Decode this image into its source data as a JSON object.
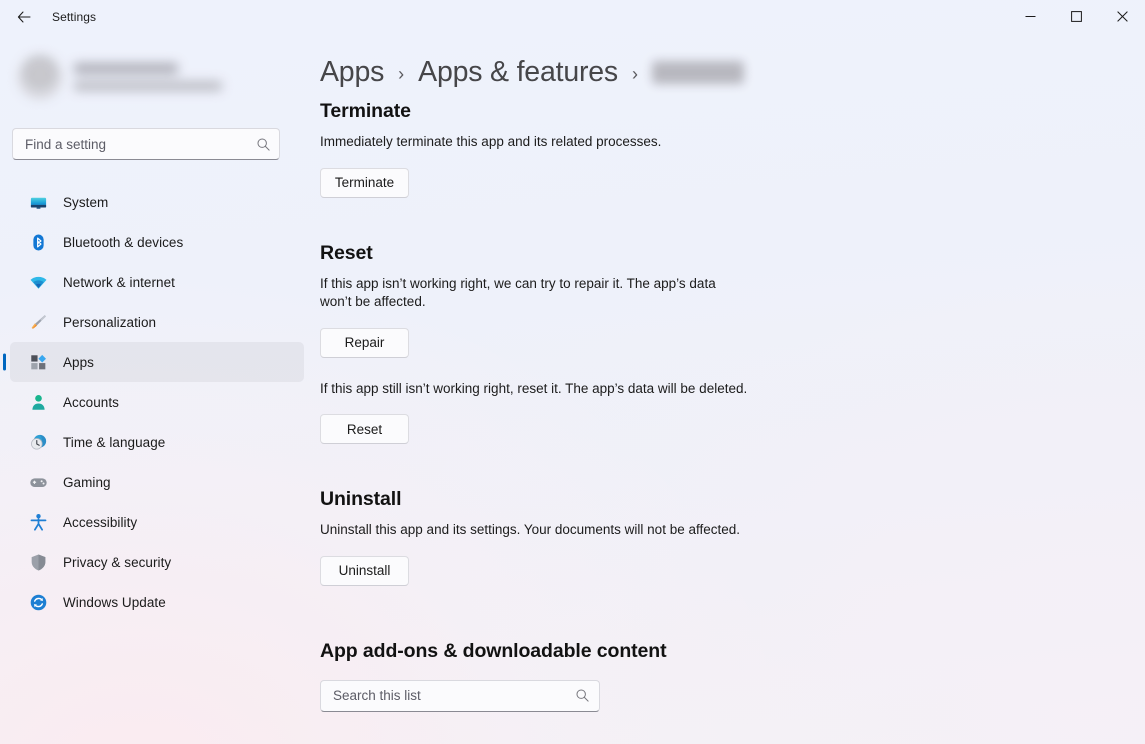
{
  "window": {
    "title": "Settings",
    "back_icon": "back-arrow-icon",
    "controls": {
      "minimize": "minimize-icon",
      "maximize": "maximize-icon",
      "close": "close-icon"
    }
  },
  "sidebar": {
    "profile": {
      "redacted": true,
      "avatar": "user-avatar"
    },
    "search": {
      "placeholder": "Find a setting",
      "value": "",
      "icon": "search-icon"
    },
    "items": [
      {
        "label": "System",
        "icon": "monitor-icon",
        "selected": false
      },
      {
        "label": "Bluetooth & devices",
        "icon": "bluetooth-icon",
        "selected": false
      },
      {
        "label": "Network & internet",
        "icon": "wifi-icon",
        "selected": false
      },
      {
        "label": "Personalization",
        "icon": "paintbrush-icon",
        "selected": false
      },
      {
        "label": "Apps",
        "icon": "apps-grid-icon",
        "selected": true
      },
      {
        "label": "Accounts",
        "icon": "person-icon",
        "selected": false
      },
      {
        "label": "Time & language",
        "icon": "clock-globe-icon",
        "selected": false
      },
      {
        "label": "Gaming",
        "icon": "gamepad-icon",
        "selected": false
      },
      {
        "label": "Accessibility",
        "icon": "accessibility-person-icon",
        "selected": false
      },
      {
        "label": "Privacy & security",
        "icon": "shield-icon",
        "selected": false
      },
      {
        "label": "Windows Update",
        "icon": "update-refresh-icon",
        "selected": false
      }
    ]
  },
  "breadcrumb": {
    "root": "Apps",
    "parent": "Apps & features",
    "current_redacted": true,
    "separator": "›"
  },
  "main": {
    "terminate": {
      "title": "Terminate",
      "description": "Immediately terminate this app and its related processes.",
      "button": "Terminate"
    },
    "reset": {
      "title": "Reset",
      "repair_description": "If this app isn’t working right, we can try to repair it. The app’s data won’t be affected.",
      "repair_button": "Repair",
      "reset_description": "If this app still isn’t working right, reset it. The app’s data will be deleted.",
      "reset_button": "Reset"
    },
    "uninstall": {
      "title": "Uninstall",
      "description": "Uninstall this app and its settings. Your documents will not be affected.",
      "button": "Uninstall"
    },
    "addons": {
      "title": "App add-ons & downloadable content",
      "search_placeholder": "Search this list",
      "search_value": "",
      "search_icon": "search-icon"
    }
  },
  "colors": {
    "accent": "#0067c0",
    "close_hover": "#c42b1c",
    "background_top": "#eef2fc",
    "background_bottom": "#f4f1f4"
  }
}
